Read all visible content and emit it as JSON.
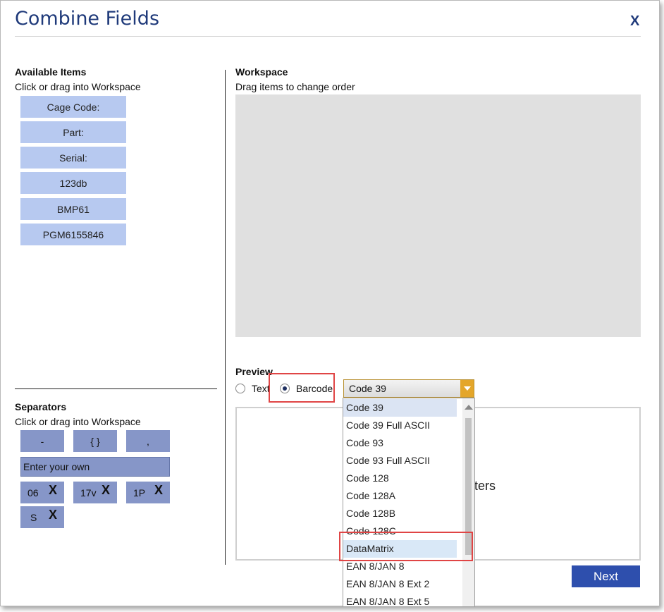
{
  "dialog": {
    "title": "Combine Fields",
    "close_label": "X"
  },
  "available": {
    "heading": "Available Items",
    "subtitle": "Click or drag into Workspace",
    "items": [
      "Cage Code:",
      "Part:",
      "Serial:",
      "123db",
      "BMP61",
      "PGM6155846"
    ]
  },
  "separators": {
    "heading": "Separators",
    "subtitle": "Click or drag into Workspace",
    "items": [
      "-",
      "{ }",
      ","
    ],
    "enter_placeholder": "Enter your own",
    "custom": [
      {
        "label": "06",
        "delete": "X"
      },
      {
        "label": "17v",
        "delete": "X"
      },
      {
        "label": "1P",
        "delete": "X"
      },
      {
        "label": "S",
        "delete": "X"
      }
    ]
  },
  "workspace": {
    "heading": "Workspace",
    "subtitle": "Drag items to change order"
  },
  "preview": {
    "heading": "Preview",
    "text_option": "Text",
    "barcode_option": "Barcode",
    "selected_mode": "Barcode",
    "barcode_type": "Code 39",
    "partial_text": "ters",
    "dropdown_options": [
      "Code 39",
      "Code 39 Full ASCII",
      "Code 93",
      "Code 93 Full ASCII",
      "Code 128",
      "Code 128A",
      "Code 128B",
      "Code 128C",
      "DataMatrix",
      "EAN 8/JAN 8",
      "EAN 8/JAN 8 Ext 2",
      "EAN 8/JAN 8 Ext 5"
    ],
    "highlighted_option": "DataMatrix"
  },
  "footer": {
    "next_label": "Next"
  },
  "colors": {
    "title": "#1f3a7a",
    "available_item": "#b7c9f0",
    "separator_item": "#8696c8",
    "next_button": "#2e4fad",
    "combo_arrow": "#e4a62a",
    "highlight": "#e04545"
  }
}
